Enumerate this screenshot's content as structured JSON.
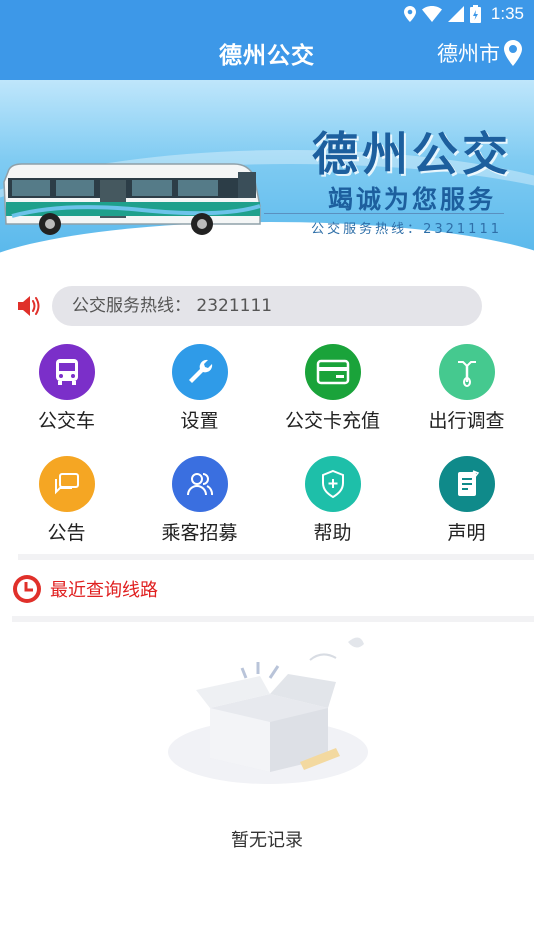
{
  "status_bar": {
    "time": "1:35"
  },
  "header": {
    "title": "德州公交",
    "city": "德州市"
  },
  "banner": {
    "title": "德州公交",
    "subtitle": "竭诚为您服务",
    "hotline": "公交服务热线：2321111"
  },
  "notice": {
    "text": "公交服务热线： 2321111"
  },
  "grid": {
    "items": [
      {
        "label": "公交车",
        "icon": "bus-icon",
        "color": "#7b2fc9"
      },
      {
        "label": "设置",
        "icon": "wrench-icon",
        "color": "#2f9be8"
      },
      {
        "label": "公交卡充值",
        "icon": "card-icon",
        "color": "#1aa33a"
      },
      {
        "label": "出行调查",
        "icon": "bicycle-icon",
        "color": "#45c98f"
      },
      {
        "label": "公告",
        "icon": "chat-icon",
        "color": "#f5a623"
      },
      {
        "label": "乘客招募",
        "icon": "users-icon",
        "color": "#3a6fe0"
      },
      {
        "label": "帮助",
        "icon": "shield-plus-icon",
        "color": "#1ebfa9"
      },
      {
        "label": "声明",
        "icon": "document-icon",
        "color": "#0f8a8a"
      }
    ]
  },
  "recent": {
    "label": "最近查询线路"
  },
  "empty": {
    "text": "暂无记录"
  }
}
